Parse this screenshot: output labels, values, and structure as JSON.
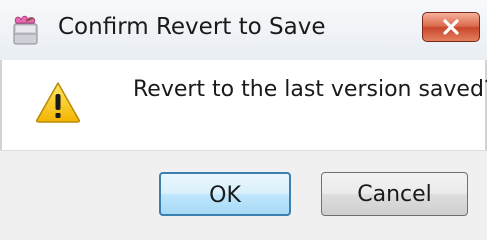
{
  "dialog": {
    "title": "Confirm Revert to Save",
    "message": "Revert to the last version saved?",
    "buttons": {
      "ok_label": "OK",
      "cancel_label": "Cancel"
    }
  },
  "icons": {
    "app_icon": "app-icon",
    "close_icon": "close-icon",
    "message_icon": "warning-icon"
  },
  "colors": {
    "close_button": "#c9452a",
    "default_button_border": "#3c7fb1",
    "warning_yellow": "#f6c400"
  }
}
